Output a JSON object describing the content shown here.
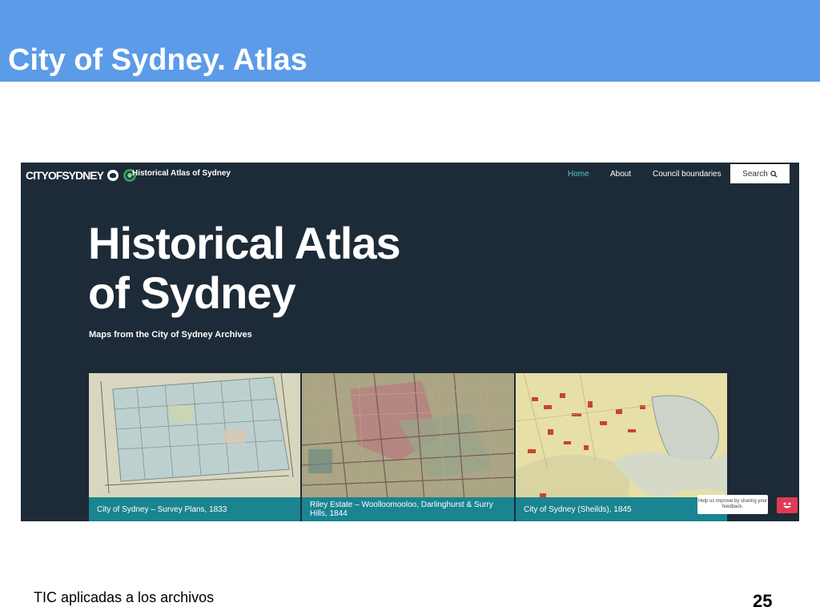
{
  "slide": {
    "title": "City of Sydney. Atlas",
    "footer": "TIC aplicadas a los archivos",
    "page_number": "25"
  },
  "site": {
    "logo_text": "CITYOFSYDNEY",
    "name": "Historical Atlas of Sydney",
    "nav": {
      "home": "Home",
      "about": "About",
      "council": "Council boundaries",
      "search": "Search"
    },
    "hero": {
      "title_line1": "Historical Atlas",
      "title_line2": "of Sydney",
      "subtitle": "Maps from the City of Sydney Archives"
    },
    "maps": [
      {
        "caption": "City of Sydney – Survey Plans, 1833"
      },
      {
        "caption": "Riley Estate – Woolloomooloo, Darlinghurst & Surry Hills, 1844"
      },
      {
        "caption": "City of Sydney (Sheilds), 1845"
      }
    ],
    "feedback": "Help us improve by sharing your feedback."
  },
  "colors": {
    "header_blue": "#5b9be8",
    "site_bg": "#1d2b38",
    "caption_teal": "#1a8491",
    "nav_active": "#5bc6d0",
    "feedback_red": "#e03b52"
  }
}
